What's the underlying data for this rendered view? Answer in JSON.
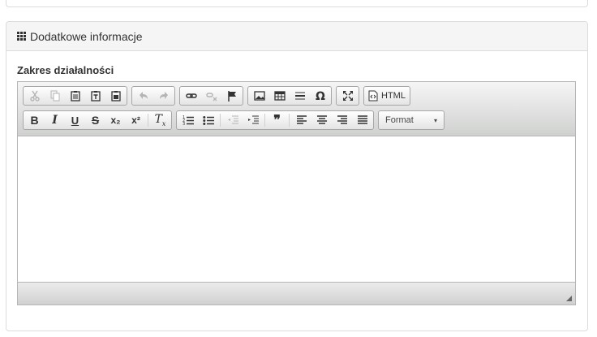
{
  "panel": {
    "title": "Dodatkowe informacje",
    "icon": "grid-icon"
  },
  "field": {
    "label": "Zakres działalności"
  },
  "toolbar": {
    "row1": [
      {
        "name": "cut-icon",
        "disabled": true
      },
      {
        "name": "copy-icon",
        "disabled": true
      },
      {
        "name": "paste-icon"
      },
      {
        "name": "paste-text-icon"
      },
      {
        "name": "paste-word-icon"
      },
      {
        "name": "undo-icon",
        "disabled": true
      },
      {
        "name": "redo-icon",
        "disabled": true
      },
      {
        "name": "link-icon"
      },
      {
        "name": "unlink-icon",
        "disabled": true
      },
      {
        "name": "anchor-flag-icon"
      },
      {
        "name": "image-icon"
      },
      {
        "name": "table-icon"
      },
      {
        "name": "horizontal-line-icon"
      },
      {
        "name": "special-char-icon"
      },
      {
        "name": "maximize-icon"
      },
      {
        "name": "source-html-icon",
        "label": "HTML"
      }
    ],
    "row2": [
      {
        "name": "bold-icon",
        "glyph": "B"
      },
      {
        "name": "italic-icon",
        "glyph": "I"
      },
      {
        "name": "underline-icon",
        "glyph": "U"
      },
      {
        "name": "strike-icon",
        "glyph": "S"
      },
      {
        "name": "subscript-icon",
        "glyph": "x₂"
      },
      {
        "name": "superscript-icon",
        "glyph": "x²"
      },
      {
        "name": "remove-format-icon",
        "glyph": "Tx"
      },
      {
        "name": "numbered-list-icon"
      },
      {
        "name": "bulleted-list-icon"
      },
      {
        "name": "outdent-icon",
        "disabled": true
      },
      {
        "name": "indent-icon"
      },
      {
        "name": "blockquote-icon",
        "glyph": "❞"
      },
      {
        "name": "align-left-icon"
      },
      {
        "name": "align-center-icon"
      },
      {
        "name": "align-right-icon"
      },
      {
        "name": "justify-icon"
      }
    ],
    "format": {
      "label": "Format",
      "arrow": "▾"
    }
  },
  "editor": {
    "content": ""
  }
}
